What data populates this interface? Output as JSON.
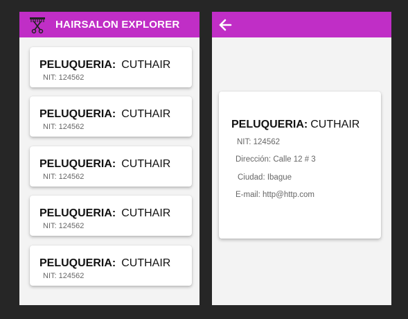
{
  "list_screen": {
    "title": "HAIRSALON EXPLORER",
    "logo_icon": "scissors-comb-icon",
    "accent_color": "#c02ec6",
    "cards": [
      {
        "label": "PELUQUERIA:",
        "name": "CUTHAIR",
        "nit": "NIT: 124562"
      },
      {
        "label": "PELUQUERIA:",
        "name": "CUTHAIR",
        "nit": "NIT: 124562"
      },
      {
        "label": "PELUQUERIA:",
        "name": "CUTHAIR",
        "nit": "NIT: 124562"
      },
      {
        "label": "PELUQUERIA:",
        "name": "CUTHAIR",
        "nit": "NIT: 124562"
      },
      {
        "label": "PELUQUERIA:",
        "name": "CUTHAIR",
        "nit": "NIT: 124562"
      }
    ]
  },
  "detail_screen": {
    "back_icon": "arrow-left-icon",
    "label": "PELUQUERIA:",
    "name": "CUTHAIR",
    "nit": "NIT: 124562",
    "direccion": "Dirección: Calle 12 # 3",
    "ciudad": "Ciudad: Ibague",
    "email": "E-mail: http@http.com"
  }
}
